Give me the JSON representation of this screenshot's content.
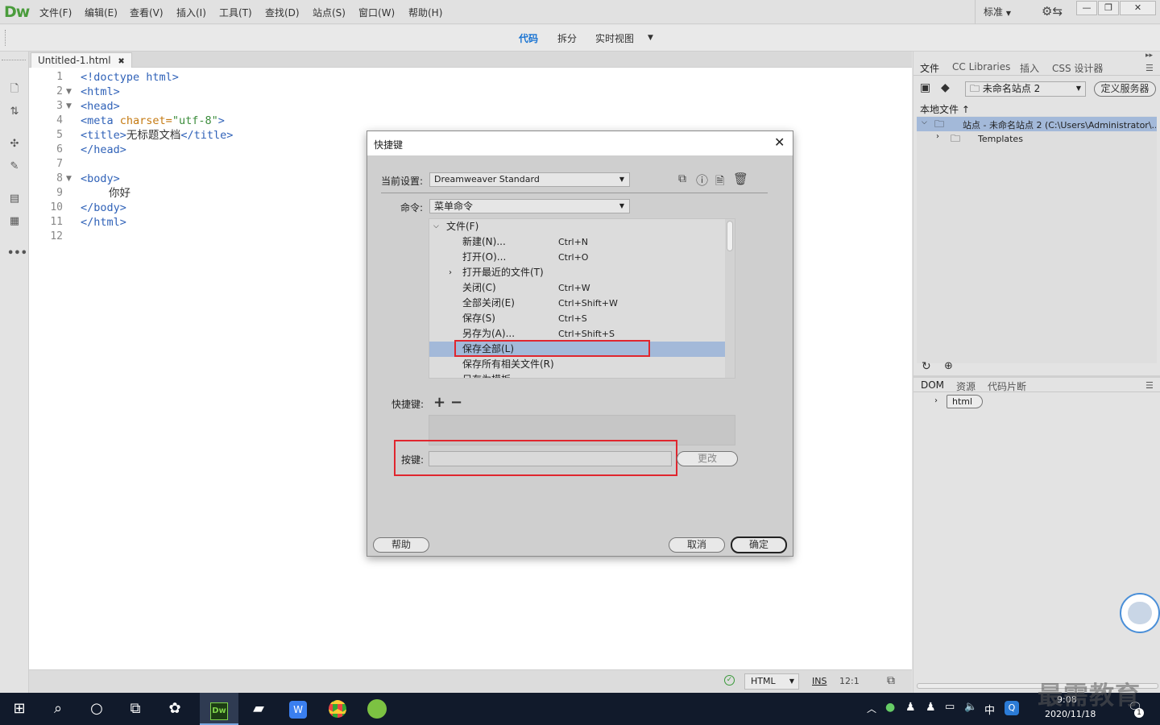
{
  "app": {
    "logo": "Dw",
    "workspace": "标准",
    "menus": [
      "文件(F)",
      "编辑(E)",
      "查看(V)",
      "插入(I)",
      "工具(T)",
      "查找(D)",
      "站点(S)",
      "窗口(W)",
      "帮助(H)"
    ]
  },
  "views": {
    "code": "代码",
    "split": "拆分",
    "live": "实时视图"
  },
  "document": {
    "tab": "Untitled-1.html",
    "lines": [
      "1",
      "2",
      "3",
      "4",
      "5",
      "6",
      "7",
      "8",
      "9",
      "10",
      "11",
      "12"
    ],
    "code": {
      "l1": "<!doctype html>",
      "l2": "<html>",
      "l3": "<head>",
      "l4a": "<meta ",
      "l4b": "charset=",
      "l4c": "\"utf-8\"",
      "l4d": ">",
      "l5a": "<title>",
      "l5b": "无标题文档",
      "l5c": "</title>",
      "l6": "</head>",
      "l8": "<body>",
      "l9": "你好",
      "l10": "</body>",
      "l11": "</html>"
    }
  },
  "status": {
    "lang": "HTML",
    "mode": "INS",
    "pos": "12:1"
  },
  "files_panel": {
    "tabs": [
      "文件",
      "CC Libraries",
      "插入",
      "CSS 设计器"
    ],
    "site": "未命名站点 2",
    "define_server": "定义服务器",
    "local_label": "本地文件",
    "root": "站点 - 未命名站点 2 (C:\\Users\\Administrator\\...",
    "folder": "Templates"
  },
  "dom_panel": {
    "tabs": [
      "DOM",
      "资源",
      "代码片断"
    ],
    "node": "html"
  },
  "dialog": {
    "title": "快捷键",
    "setting_label": "当前设置:",
    "setting_value": "Dreamweaver Standard",
    "command_label": "命令:",
    "command_value": "菜单命令",
    "items": [
      {
        "name": "文件(F)",
        "key": ""
      },
      {
        "name": "新建(N)...",
        "key": "Ctrl+N"
      },
      {
        "name": "打开(O)...",
        "key": "Ctrl+O"
      },
      {
        "name": "打开最近的文件(T)",
        "key": ""
      },
      {
        "name": "关闭(C)",
        "key": "Ctrl+W"
      },
      {
        "name": "全部关闭(E)",
        "key": "Ctrl+Shift+W"
      },
      {
        "name": "保存(S)",
        "key": "Ctrl+S"
      },
      {
        "name": "另存为(A)...",
        "key": "Ctrl+Shift+S"
      },
      {
        "name": "保存全部(L)",
        "key": ""
      },
      {
        "name": "保存所有相关文件(R)",
        "key": ""
      },
      {
        "name": "另存为模板...",
        "key": ""
      }
    ],
    "shortcut_label": "快捷键:",
    "press_label": "按键:",
    "change": "更改",
    "help": "帮助",
    "cancel": "取消",
    "ok": "确定"
  },
  "taskbar": {
    "time": "9:08",
    "date": "2020/11/18",
    "ime": "中",
    "notif": "1"
  },
  "watermark": "最需教育",
  "colors": {
    "selection": "#a3b9d9",
    "highlight": "#e0262e",
    "brand": "#4a9c3c"
  }
}
